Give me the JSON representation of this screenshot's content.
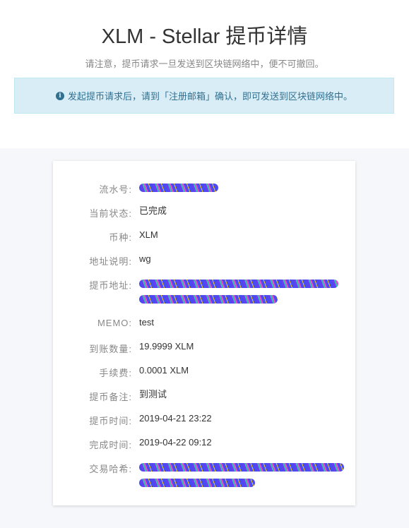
{
  "header": {
    "title": "XLM - Stellar 提币详情",
    "notice": "请注意，提币请求一旦发送到区块链网络中，便不可撤回。",
    "alert": "发起提币请求后，请到「注册邮箱」确认，即可发送到区块链网络中。",
    "alert_icon": "info-circle-icon"
  },
  "details": [
    {
      "label": "流水号:",
      "value": ""
    },
    {
      "label": "当前状态:",
      "value": "已完成"
    },
    {
      "label": "币种:",
      "value": "XLM"
    },
    {
      "label": "地址说明:",
      "value": "wg"
    },
    {
      "label": "提币地址:",
      "value": ""
    },
    {
      "label": "MEMO:",
      "value": "test"
    },
    {
      "label": "到账数量:",
      "value": "19.9999 XLM"
    },
    {
      "label": "手续费:",
      "value": "0.0001 XLM"
    },
    {
      "label": "提币备注:",
      "value": "到测试"
    },
    {
      "label": "提币时间:",
      "value": "2019-04-21 23:22"
    },
    {
      "label": "完成时间:",
      "value": "2019-04-22 09:12"
    },
    {
      "label": "交易哈希:",
      "value": ""
    }
  ]
}
